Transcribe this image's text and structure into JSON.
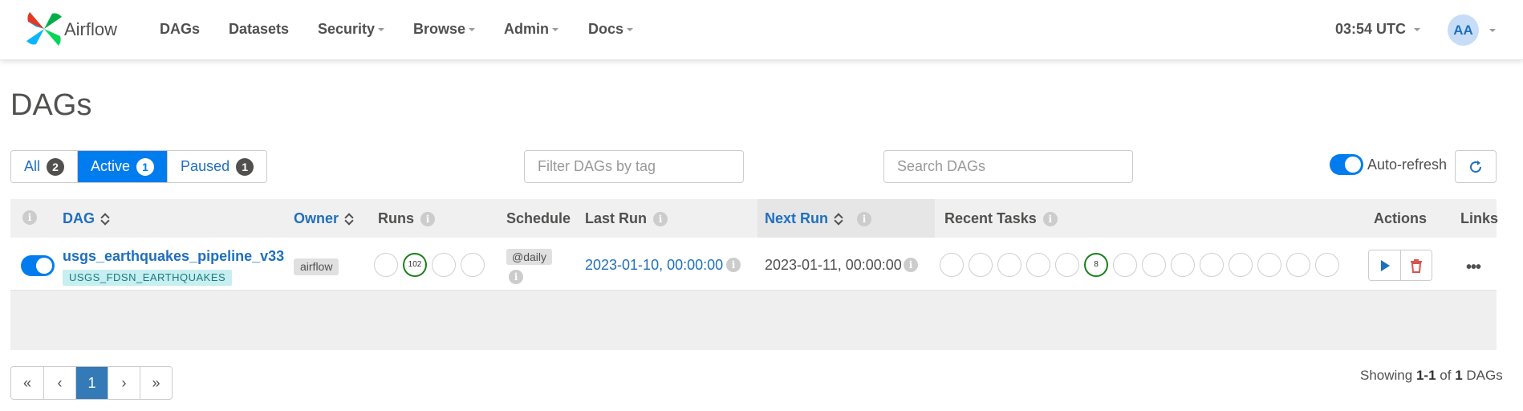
{
  "navbar": {
    "brand": "Airflow",
    "items": [
      "DAGs",
      "Datasets",
      "Security",
      "Browse",
      "Admin",
      "Docs"
    ],
    "clock": "03:54 UTC",
    "avatar": "AA"
  },
  "page": {
    "title": "DAGs"
  },
  "filters": {
    "all": {
      "label": "All",
      "count": "2"
    },
    "active": {
      "label": "Active",
      "count": "1"
    },
    "paused": {
      "label": "Paused",
      "count": "1"
    },
    "tag_placeholder": "Filter DAGs by tag",
    "search_placeholder": "Search DAGs",
    "autorefresh_label": "Auto-refresh",
    "autorefresh_on": true
  },
  "table": {
    "headers": {
      "dag": "DAG",
      "owner": "Owner",
      "runs": "Runs",
      "schedule": "Schedule",
      "last_run": "Last Run",
      "next_run": "Next Run",
      "recent_tasks": "Recent Tasks",
      "actions": "Actions",
      "links": "Links"
    },
    "rows": [
      {
        "dag_id": "usgs_earthquakes_pipeline_v33",
        "tag": "USGS_FDSN_EARTHQUAKES",
        "owner": "airflow",
        "runs": [
          "",
          "102",
          "",
          ""
        ],
        "schedule": "@daily",
        "last_run": "2023-01-10, 00:00:00",
        "next_run": "2023-01-11, 00:00:00",
        "recent_tasks": [
          "",
          "",
          "",
          "",
          "",
          "8",
          "",
          "",
          "",
          "",
          "",
          "",
          "",
          ""
        ],
        "more": "•••"
      }
    ]
  },
  "pagination": {
    "first": "«",
    "prev": "‹",
    "current": "1",
    "next": "›",
    "last": "»",
    "showing_prefix": "Showing",
    "showing_range": "1-1",
    "showing_of": "of",
    "showing_total": "1",
    "showing_suffix": "DAGs"
  },
  "colors": {
    "primary": "#017cee",
    "success": "#1a7f1a",
    "danger": "#d9534f",
    "link": "#1f6fbf"
  }
}
